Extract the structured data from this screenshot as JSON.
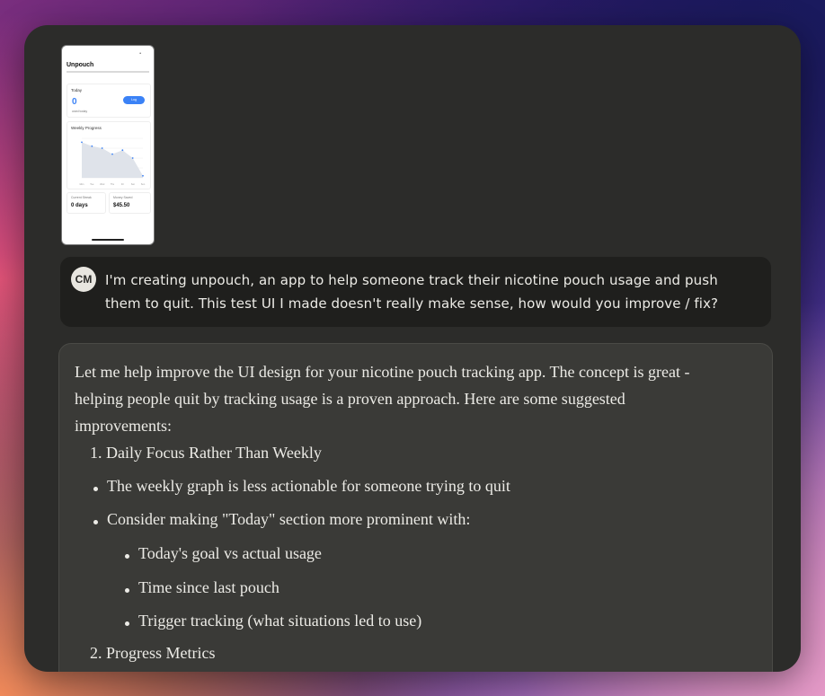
{
  "thumbnail": {
    "app_title": "Unpouch",
    "status_icon": "•",
    "today_label": "Today",
    "today_value": "0",
    "today_sub": "used today",
    "log_button": "Log",
    "weekly_label": "Weekly Progress",
    "stat1_label": "Current Streak",
    "stat1_value": "0 days",
    "stat2_label": "Money Saved",
    "stat2_value": "$45.50",
    "chart_data": {
      "type": "area",
      "x": [
        "Mon",
        "Tue",
        "Wed",
        "Thu",
        "Fri",
        "Sat",
        "Sun"
      ],
      "values": [
        9,
        8,
        7.5,
        6,
        7,
        5,
        0.5
      ],
      "ylim": [
        0,
        10
      ]
    }
  },
  "user_message": {
    "avatar_initials": "CM",
    "text": "I'm creating unpouch, an app to help someone track their nicotine pouch usage and push them to quit. This test UI I made doesn't really make sense, how would you improve / fix?"
  },
  "assistant_message": {
    "intro": "Let me help improve the UI design for your nicotine pouch tracking app. The concept is great - helping people quit by tracking usage is a proven approach. Here are some suggested improvements:",
    "item1": "1. Daily Focus Rather Than Weekly",
    "bullet1": "The weekly graph is less actionable for someone trying to quit",
    "bullet2": "Consider making \"Today\" section more prominent with:",
    "sub1": "Today's goal vs actual usage",
    "sub2": "Time since last pouch",
    "sub3": "Trigger tracking (what situations led to use)",
    "item2": "2. Progress Metrics"
  }
}
